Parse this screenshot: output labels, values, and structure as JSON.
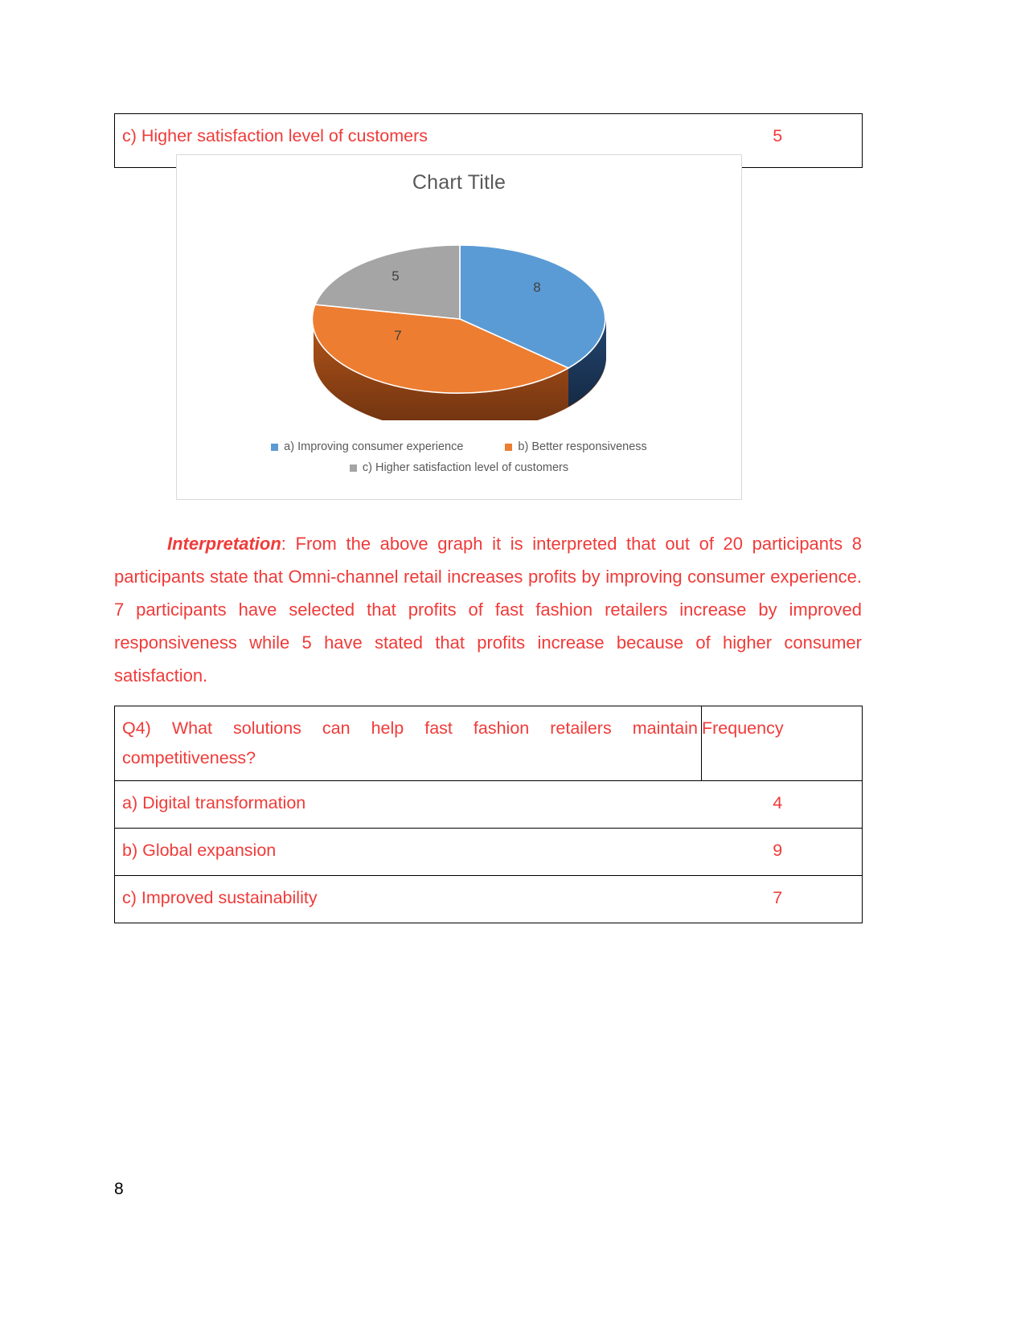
{
  "page": {
    "number": "8",
    "text_color": "#ef3b39"
  },
  "previous_table": {
    "rows": [
      {
        "label": "c) Higher satisfaction level of customers",
        "frequency": "5"
      }
    ]
  },
  "chart_data": {
    "type": "pie",
    "title": "Chart Title",
    "categories": [
      "a) Improving consumer experience",
      "b) Better responsiveness",
      "c) Higher satisfaction level of customers"
    ],
    "values": [
      8,
      7,
      5
    ],
    "data_labels": [
      "8",
      "7",
      "5"
    ],
    "colors": [
      "#5b9bd5",
      "#ed7d31",
      "#a5a5a5"
    ],
    "side_colors": [
      "#1f3864",
      "#843c0c",
      "#6f6f6f"
    ],
    "legend_position": "bottom",
    "three_d": true,
    "total": 20,
    "xlabel": "",
    "ylabel": ""
  },
  "interpretation": {
    "label": "Interpretation",
    "body": ": From the above graph it is interpreted that out of 20 participants 8 participants state that Omni-channel retail increases profits by improving consumer experience. 7 participants have selected that profits of fast fashion retailers increase by improved responsiveness while 5 have stated that profits increase because of higher consumer satisfaction."
  },
  "q4_table": {
    "question": "Q4)  What  solutions  can  help  fast  fashion  retailers  maintain competitiveness?",
    "frequency_header": "Frequency",
    "options": [
      {
        "label": "a) Digital transformation",
        "frequency": "4"
      },
      {
        "label": "b) Global expansion",
        "frequency": "9"
      },
      {
        "label": "c) Improved sustainability",
        "frequency": "7"
      }
    ]
  }
}
